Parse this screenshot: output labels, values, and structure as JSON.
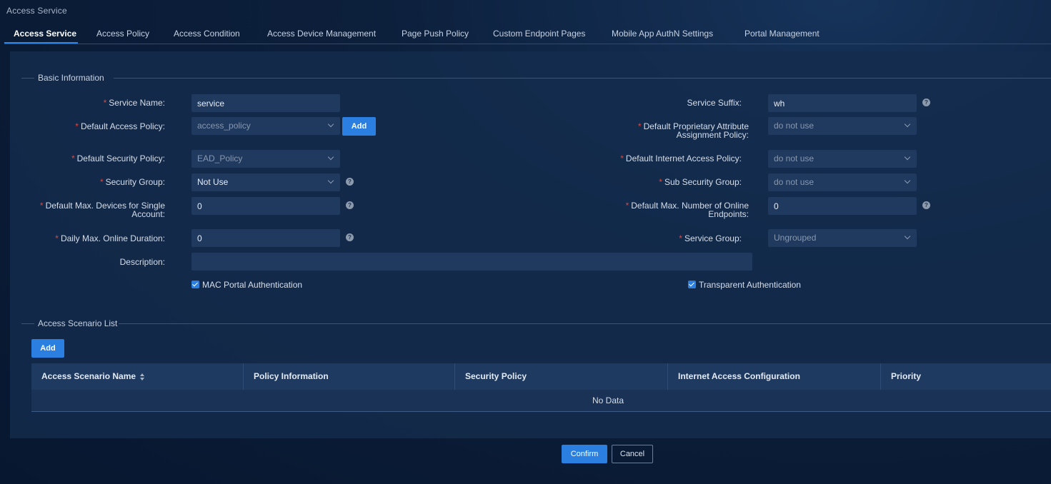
{
  "window": {
    "title": "Access Service"
  },
  "tabs": [
    {
      "label": "Access Service",
      "active": true
    },
    {
      "label": "Access Policy"
    },
    {
      "label": "Access Condition"
    },
    {
      "label": "Access Device Management"
    },
    {
      "label": "Page Push Policy"
    },
    {
      "label": "Custom Endpoint Pages"
    },
    {
      "label": "Mobile App AuthN Settings"
    },
    {
      "label": "Portal Management"
    }
  ],
  "basic": {
    "section_title": "Basic Information",
    "service_name": {
      "label": "Service Name:",
      "value": "service"
    },
    "service_suffix": {
      "label": "Service Suffix:",
      "value": "wh"
    },
    "default_access_policy": {
      "label": "Default Access Policy:",
      "value": "access_policy",
      "add_label": "Add"
    },
    "default_proprietary": {
      "label_line1": "Default Proprietary Attribute",
      "label_line2": "Assignment Policy:",
      "value": "do not use"
    },
    "default_security_policy": {
      "label": "Default Security Policy:",
      "value": "EAD_Policy"
    },
    "default_internet_access": {
      "label": "Default Internet Access Policy:",
      "value": "do not use"
    },
    "security_group": {
      "label": "Security Group:",
      "value": "Not Use"
    },
    "sub_security_group": {
      "label": "Sub Security Group:",
      "value": "do not use"
    },
    "max_devices": {
      "label_line1": "Default Max. Devices for Single",
      "label_line2": "Account:",
      "value": "0"
    },
    "max_online": {
      "label_line1": "Default Max. Number of Online",
      "label_line2": "Endpoints:",
      "value": "0"
    },
    "daily_max": {
      "label": "Daily Max. Online Duration:",
      "value": "0"
    },
    "service_group": {
      "label": "Service Group:",
      "value": "Ungrouped"
    },
    "description": {
      "label": "Description:",
      "value": ""
    },
    "mac_portal": {
      "label": "MAC Portal Authentication",
      "checked": true
    },
    "transparent": {
      "label": "Transparent Authentication",
      "checked": true
    },
    "required_mark": "*",
    "help_glyph": "?"
  },
  "scenario": {
    "section_title": "Access Scenario List",
    "add_label": "Add",
    "columns": [
      "Access Scenario Name",
      "Policy Information",
      "Security Policy",
      "Internet Access Configuration",
      "Priority"
    ],
    "empty_text": "No Data"
  },
  "footer": {
    "confirm_label": "Confirm",
    "cancel_label": "Cancel"
  },
  "colors": {
    "accent": "#2a7fe0",
    "required": "#e0463e",
    "panel": "#152d4e"
  }
}
